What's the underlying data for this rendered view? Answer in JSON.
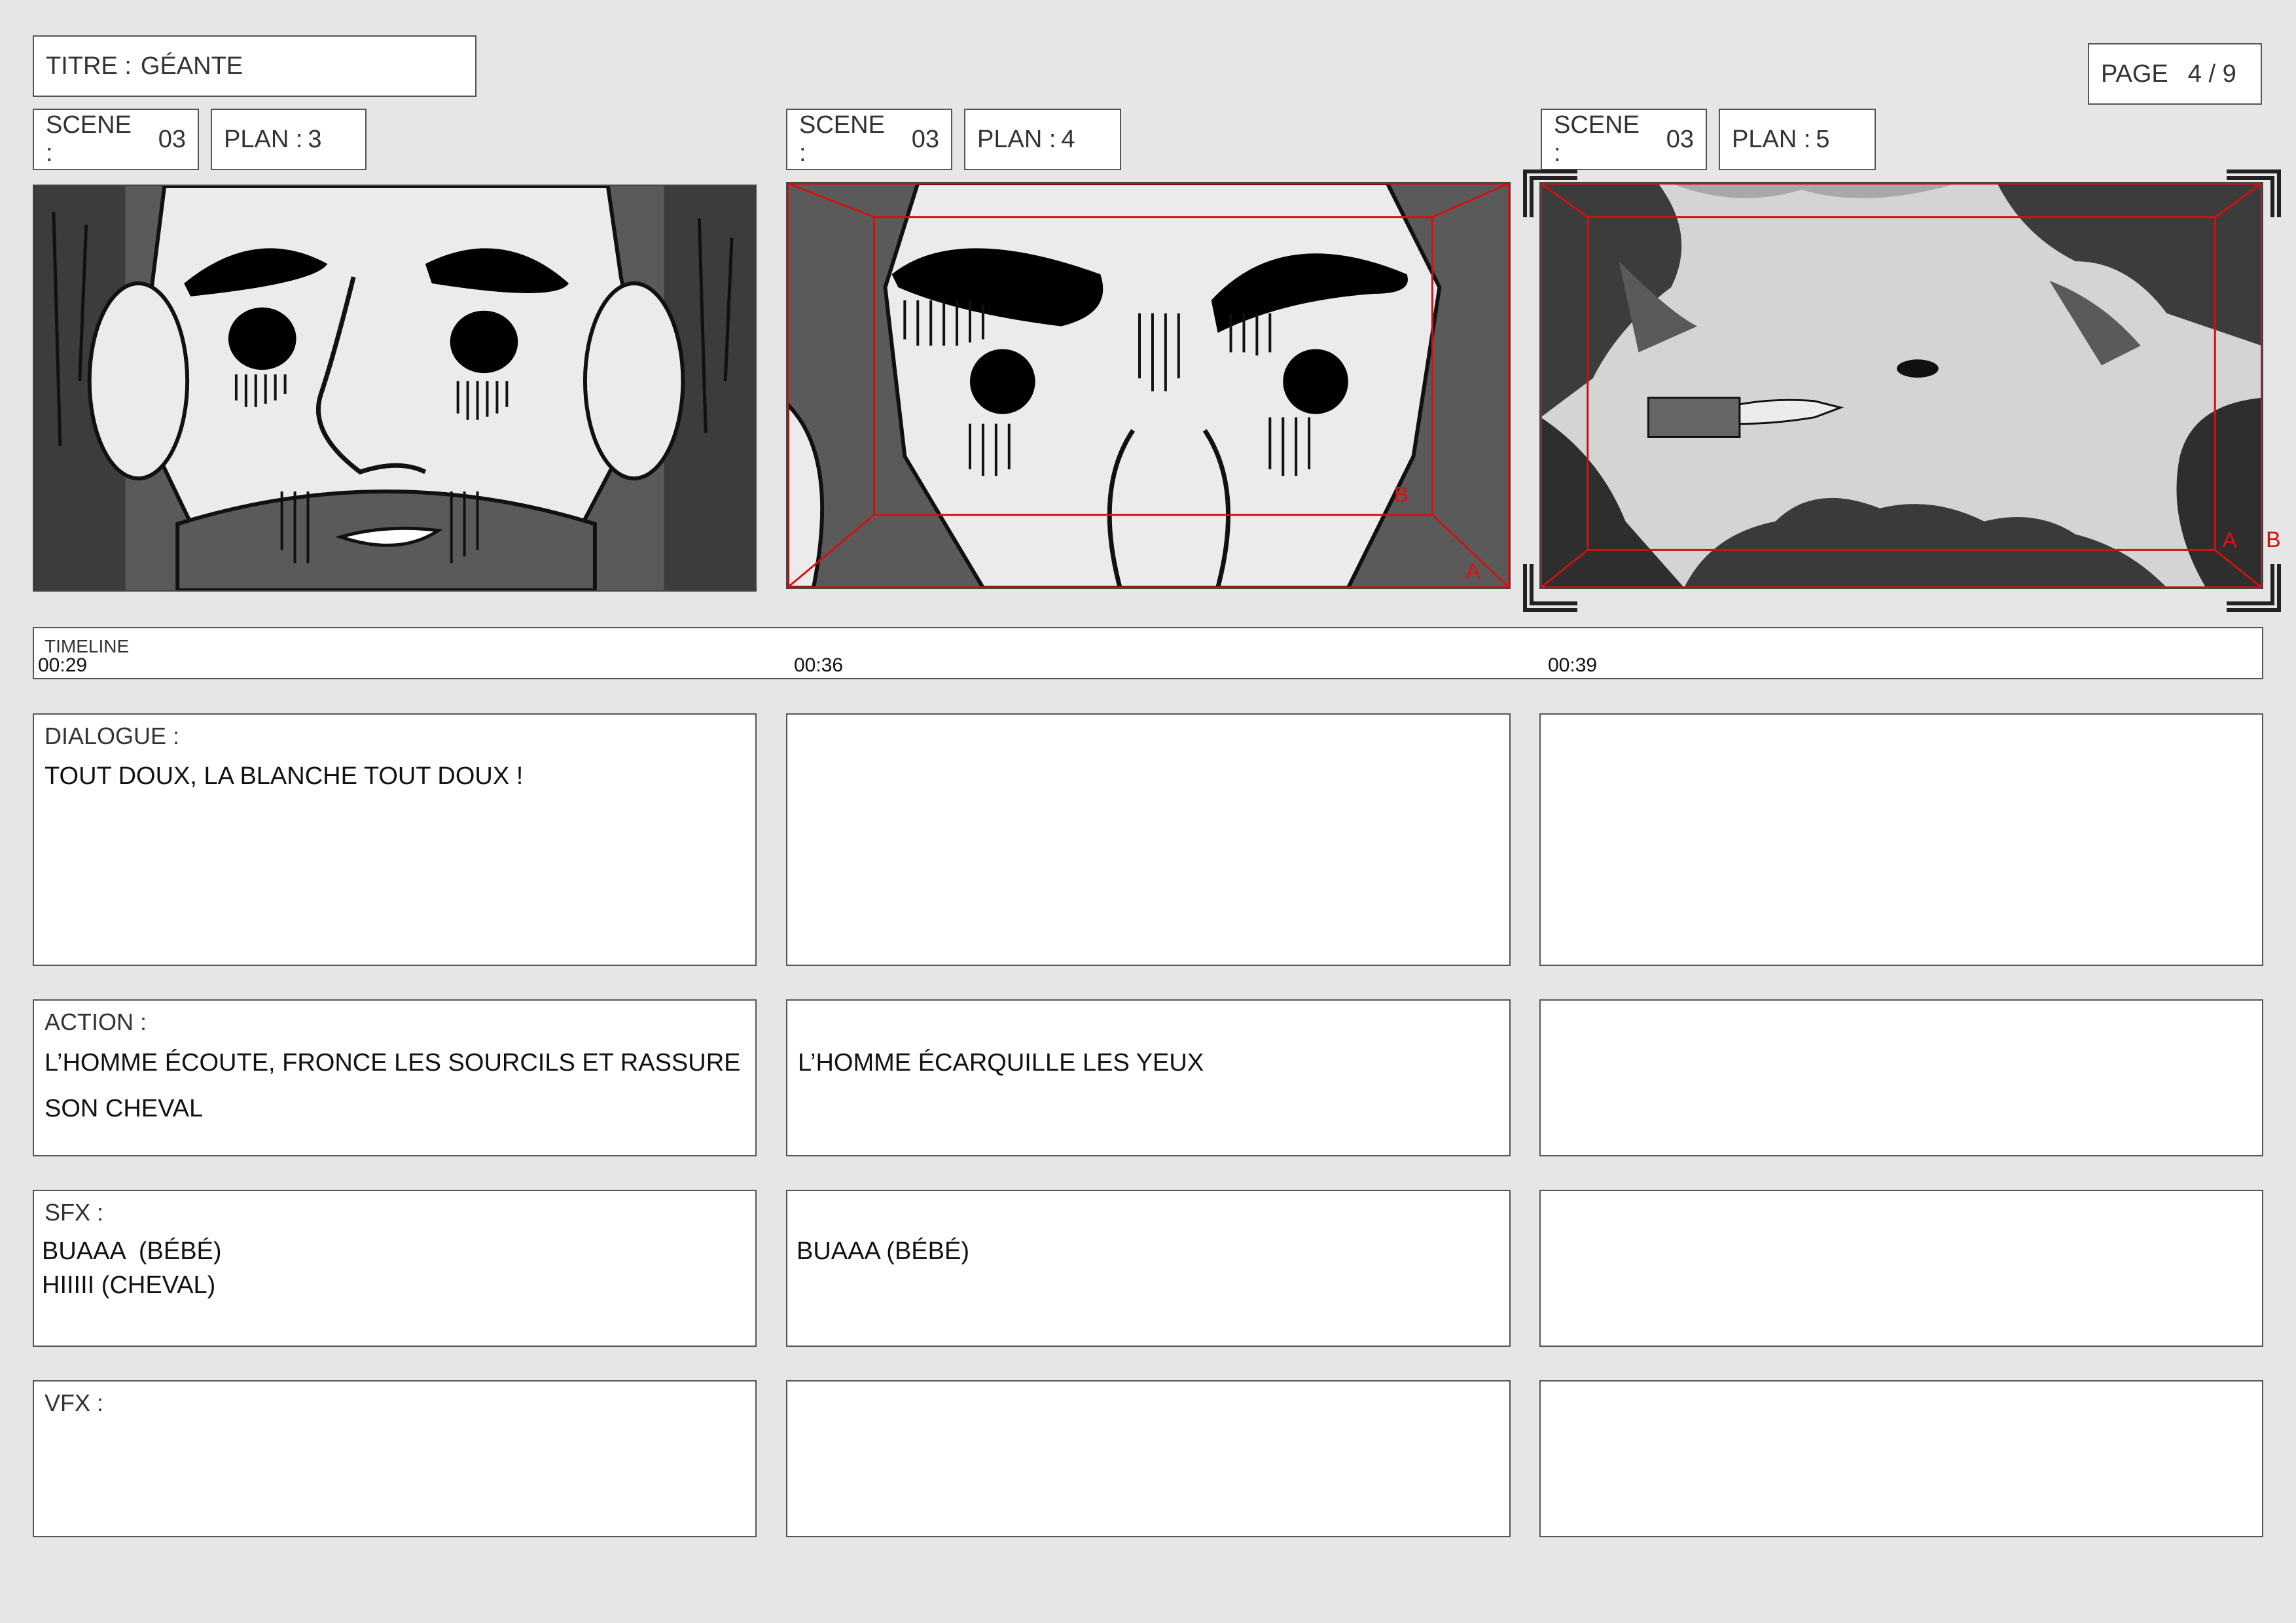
{
  "header": {
    "title_label": "TITRE :",
    "title_value": "GÉANTE",
    "page_label": "PAGE",
    "page_value": "4 / 9"
  },
  "shots": [
    {
      "scene_label": "SCENE :",
      "scene": "03",
      "plan_label": "PLAN :",
      "plan": "3",
      "timecode": "00:29",
      "dialogue": "TOUT DOUX, LA BLANCHE TOUT DOUX !",
      "action": "L’HOMME ÉCOUTE, FRONCE LES SOURCILS ET RASSURE\nSON CHEVAL",
      "sfx": "BUAAA  (BÉBÉ)\nHIIIII (CHEVAL)",
      "vfx": ""
    },
    {
      "scene_label": "SCENE :",
      "scene": "03",
      "plan_label": "PLAN :",
      "plan": "4",
      "timecode": "00:36",
      "dialogue": "",
      "action": "L’HOMME ÉCARQUILLE LES YEUX",
      "sfx": "BUAAA (BÉBÉ)",
      "vfx": ""
    },
    {
      "scene_label": "SCENE :",
      "scene": "03",
      "plan_label": "PLAN :",
      "plan": "5",
      "timecode": "00:39",
      "dialogue": "",
      "action": "",
      "sfx": "",
      "vfx": ""
    }
  ],
  "timeline": {
    "label": "TIMELINE"
  },
  "sections": {
    "dialogue_label": "DIALOGUE :",
    "action_label": "ACTION :",
    "sfx_label": "SFX :",
    "vfx_label": "VFX :"
  },
  "frame_markers": {
    "a": "A",
    "b": "B"
  },
  "colors": {
    "frame_guide": "#d11111",
    "paper": "#ffffff",
    "background": "#e6e6e6"
  }
}
